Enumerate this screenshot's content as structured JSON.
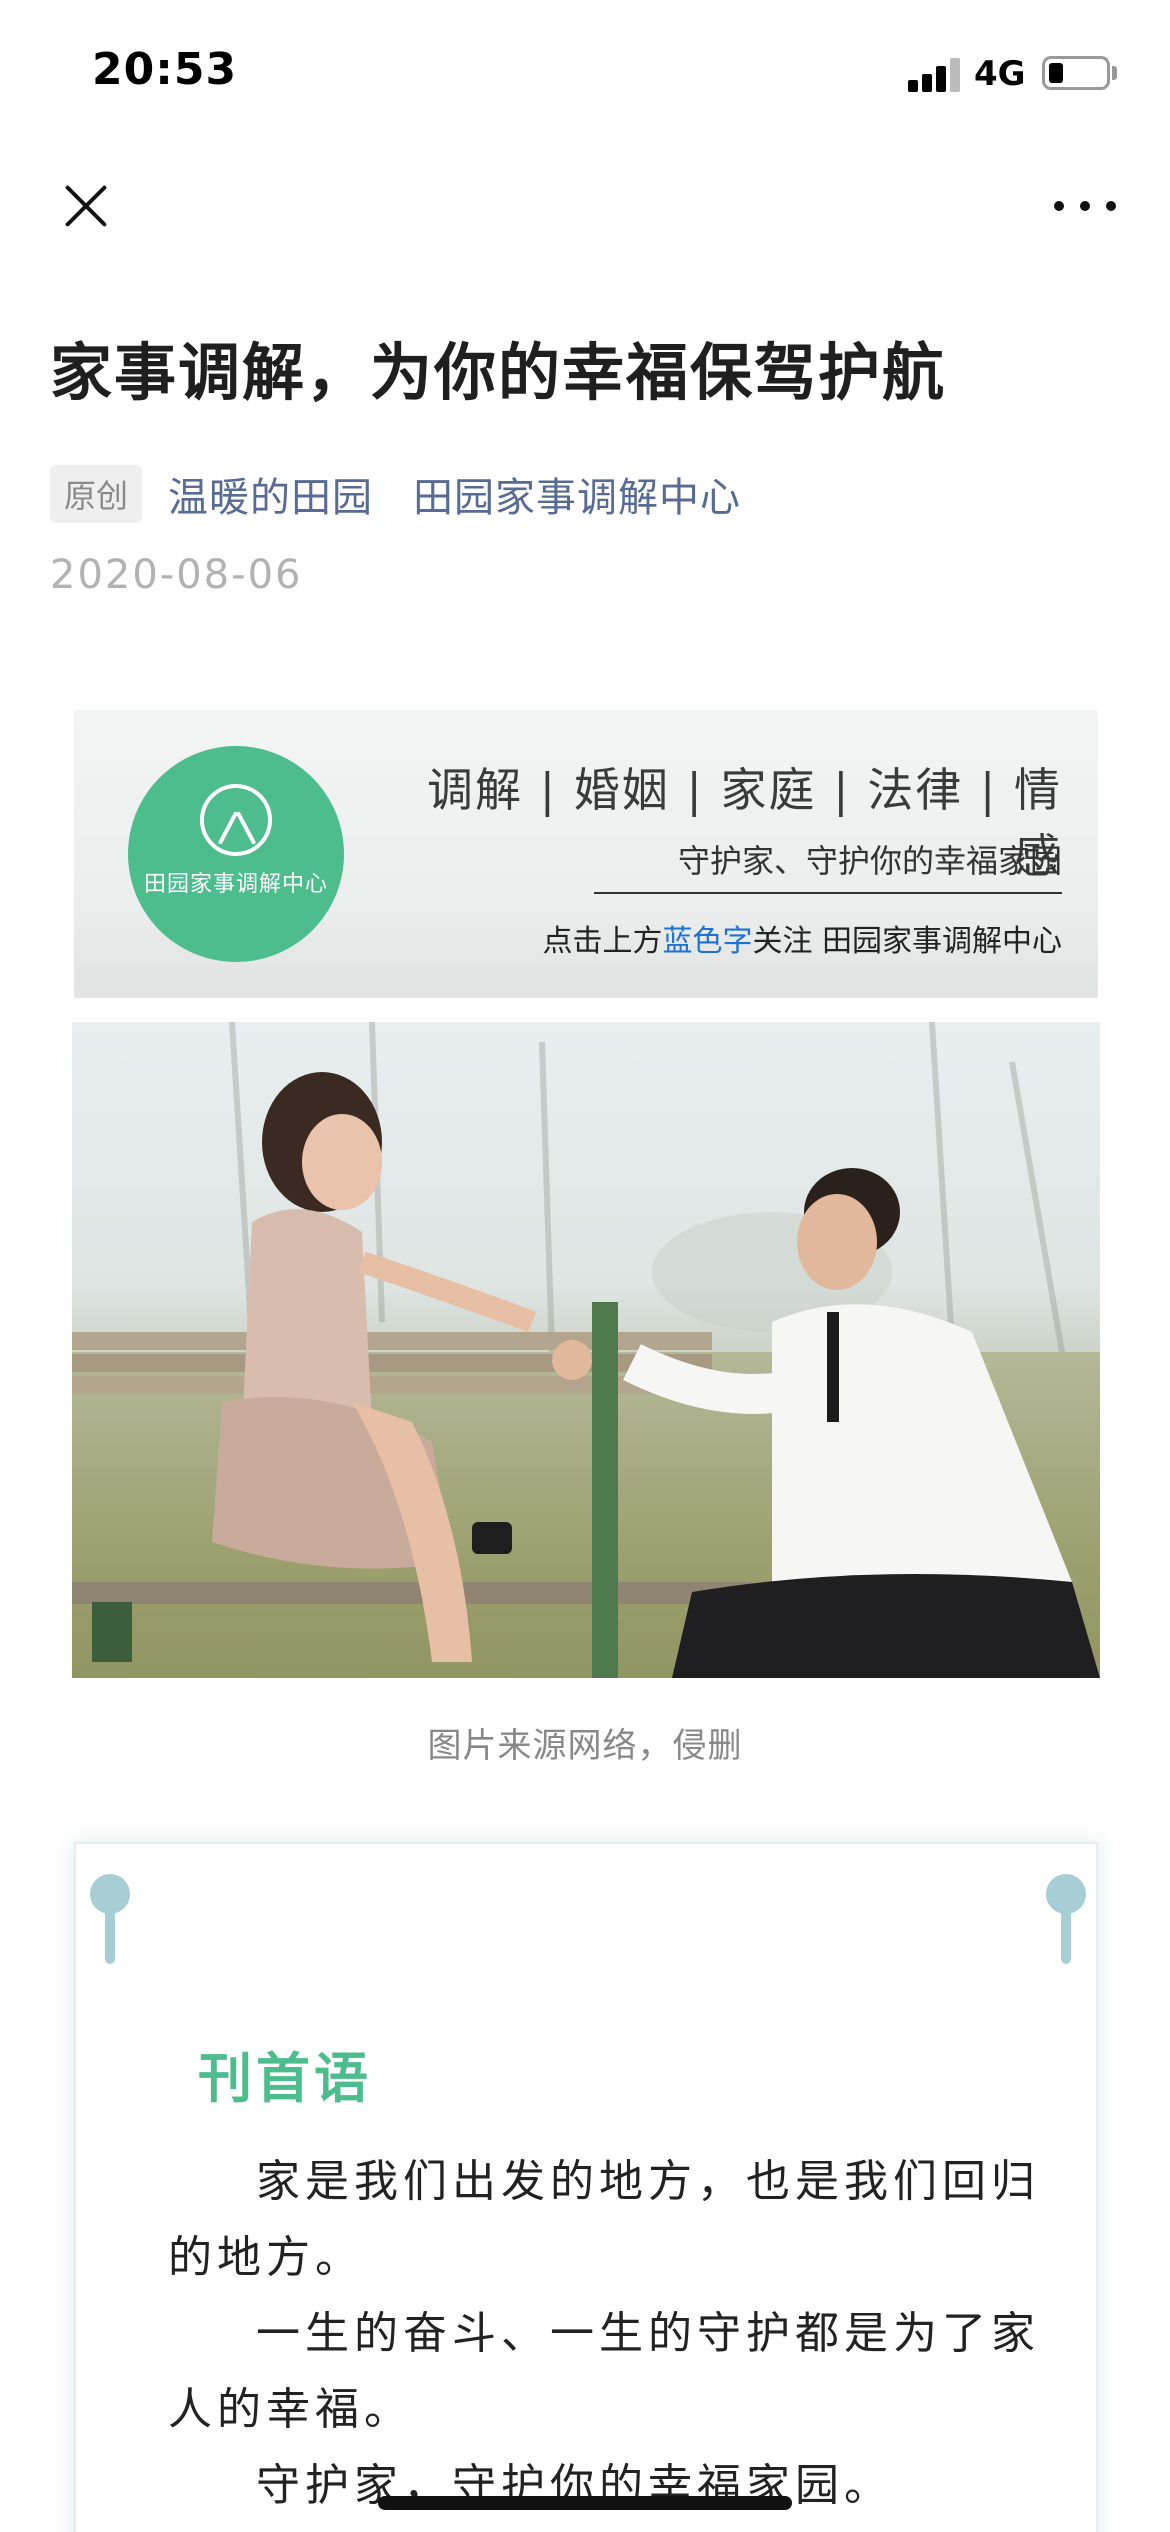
{
  "status_bar": {
    "time": "20:53",
    "network": "4G",
    "battery_level": 0.25
  },
  "nav": {
    "close_icon": "close-icon",
    "more_icon": "more-icon"
  },
  "article": {
    "title": "家事调解，为你的幸福保驾护航",
    "badge": "原创",
    "author": "温暖的田园",
    "account": "田园家事调解中心",
    "date": "2020-08-06"
  },
  "banner": {
    "logo_text": "田园家事调解中心",
    "categories": "调解 | 婚姻 | 家庭 | 法律 | 情感",
    "slogan": "守护家、守护你的幸福家园",
    "follow_prefix": "点击上方",
    "follow_highlight": "蓝色字",
    "follow_suffix": "关注 田园家事调解中心",
    "accent_color": "#4dbd8d",
    "highlight_color": "#1e72d6"
  },
  "photo": {
    "caption": "图片来源网络，侵删"
  },
  "card": {
    "heading": "刊首语",
    "paragraphs": [
      "家是我们出发的地方，也是我们回归的地方。",
      "一生的奋斗、一生的守护都是为了家人的幸福。",
      "守护家，守护你的幸福家园。"
    ]
  }
}
